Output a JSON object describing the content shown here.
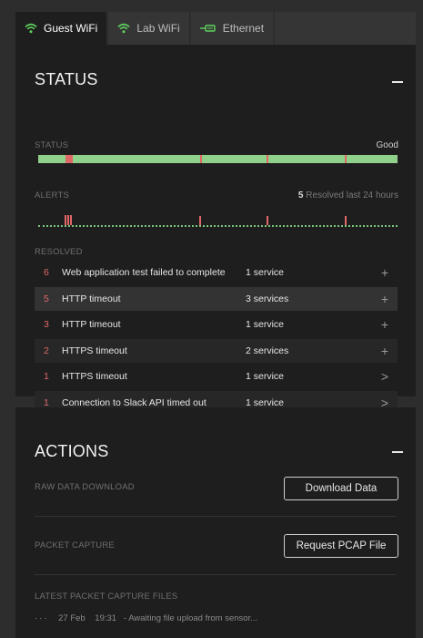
{
  "tabs": [
    {
      "label": "Guest WiFi",
      "icon": "wifi-icon",
      "active": true
    },
    {
      "label": "Lab WiFi",
      "icon": "wifi-icon",
      "active": false
    },
    {
      "label": "Ethernet",
      "icon": "ethernet-icon",
      "active": false
    }
  ],
  "status": {
    "title": "STATUS",
    "status_label": "STATUS",
    "status_value": "Good",
    "alerts_label": "ALERTS",
    "alerts_count": "5",
    "alerts_summary": "Resolved last 24 hours",
    "resolved_label": "RESOLVED",
    "rows": [
      {
        "count": "6",
        "description": "Web application test failed to complete",
        "services": "1 service",
        "action": "+"
      },
      {
        "count": "5",
        "description": "HTTP timeout",
        "services": "3 services",
        "action": "+"
      },
      {
        "count": "3",
        "description": "HTTP timeout",
        "services": "1 service",
        "action": "+"
      },
      {
        "count": "2",
        "description": "HTTPS timeout",
        "services": "2 services",
        "action": "+"
      },
      {
        "count": "1",
        "description": "HTTPS timeout",
        "services": "1 service",
        "action": ">"
      },
      {
        "count": "1",
        "description": "Connection to Slack API timed out",
        "services": "1 service",
        "action": ">"
      }
    ]
  },
  "actions": {
    "title": "ACTIONS",
    "raw_data_label": "RAW DATA DOWNLOAD",
    "download_button": "Download Data",
    "packet_capture_label": "PACKET CAPTURE",
    "pcap_button": "Request PCAP File",
    "latest_files_label": "LATEST PACKET CAPTURE FILES",
    "latest_file": {
      "dots": "···",
      "date": "27 Feb",
      "time": "19:31",
      "message": "- Awaiting file upload from sensor..."
    }
  },
  "colors": {
    "good": "#8fd18b",
    "alert": "#e06767",
    "panel": "#1e1e1e",
    "background": "#2d2d2d"
  }
}
